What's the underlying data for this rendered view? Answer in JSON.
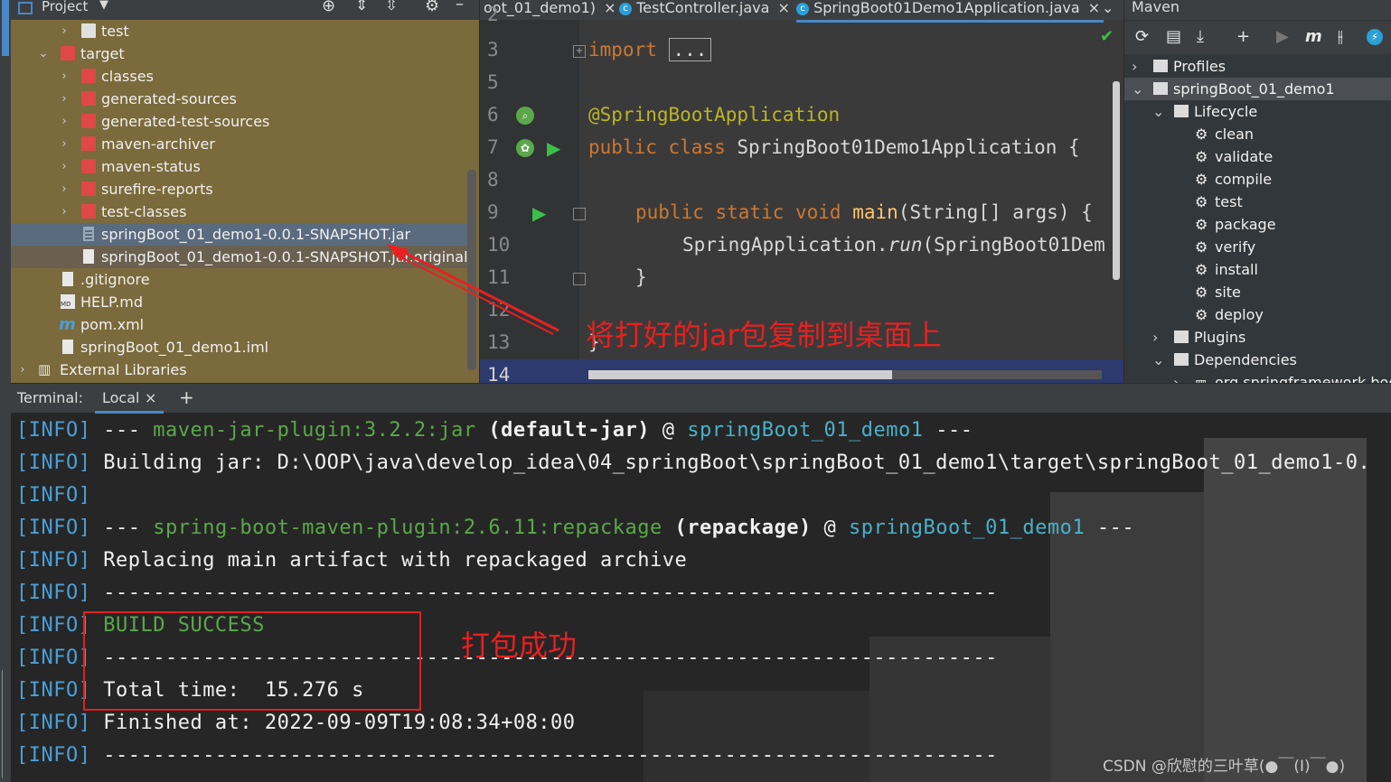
{
  "project": {
    "header_title": "Project",
    "tree": [
      {
        "label": "test",
        "kind": "folder-grey",
        "depth": 3
      },
      {
        "label": "target",
        "kind": "folder-red",
        "depth": 2
      },
      {
        "label": "classes",
        "kind": "folder-red",
        "depth": 3
      },
      {
        "label": "generated-sources",
        "kind": "folder-red",
        "depth": 3
      },
      {
        "label": "generated-test-sources",
        "kind": "folder-red",
        "depth": 3
      },
      {
        "label": "maven-archiver",
        "kind": "folder-red",
        "depth": 3
      },
      {
        "label": "maven-status",
        "kind": "folder-red",
        "depth": 3
      },
      {
        "label": "surefire-reports",
        "kind": "folder-red",
        "depth": 3
      },
      {
        "label": "test-classes",
        "kind": "folder-red",
        "depth": 3
      },
      {
        "label": "springBoot_01_demo1-0.0.1-SNAPSHOT.jar",
        "kind": "jar-file",
        "depth": 3
      },
      {
        "label": "springBoot_01_demo1-0.0.1-SNAPSHOT.jar.original",
        "kind": "file",
        "depth": 3
      },
      {
        "label": ".gitignore",
        "kind": "file",
        "depth": 2
      },
      {
        "label": "HELP.md",
        "kind": "md-file",
        "depth": 2
      },
      {
        "label": "pom.xml",
        "kind": "maven-file",
        "depth": 2
      },
      {
        "label": "springBoot_01_demo1.iml",
        "kind": "file",
        "depth": 2
      },
      {
        "label": "External Libraries",
        "kind": "libraries",
        "depth": 1
      }
    ]
  },
  "editor": {
    "tabs": [
      {
        "label": "oot_01_demo1)"
      },
      {
        "label": "TestController.java"
      },
      {
        "label": "SpringBoot01Demo1Application.java"
      }
    ],
    "line_numbers": [
      "2",
      "3",
      "5",
      "6",
      "7",
      "8",
      "9",
      "10",
      "11",
      "12",
      "13",
      "14"
    ],
    "code": {
      "import_kw": "import",
      "import_fold": "...",
      "annotation": "@SpringBootApplication",
      "class_kw": "public class",
      "class_name": " SpringBoot01Demo1Application {",
      "main_kw": "public static void",
      "main_name": "main",
      "main_args": "(String[] args) {",
      "run_prefix": "SpringApplication.",
      "run_method": "run",
      "run_suffix": "(SpringBoot01Dem",
      "close_brace_1": "}",
      "close_brace_2": "}"
    }
  },
  "maven": {
    "title": "Maven",
    "items": [
      {
        "label": "Profiles"
      },
      {
        "label": "springBoot_01_demo1"
      },
      {
        "label": "Lifecycle"
      },
      {
        "label": "clean"
      },
      {
        "label": "validate"
      },
      {
        "label": "compile"
      },
      {
        "label": "test"
      },
      {
        "label": "package"
      },
      {
        "label": "verify"
      },
      {
        "label": "install"
      },
      {
        "label": "site"
      },
      {
        "label": "deploy"
      },
      {
        "label": "Plugins"
      },
      {
        "label": "Dependencies"
      },
      {
        "label": "org.springframework.boo"
      }
    ]
  },
  "terminal": {
    "label": "Terminal:",
    "tab": "Local",
    "add": "+",
    "lines": [
      {
        "tag": "[INFO]",
        "a": " --- ",
        "b": "maven-jar-plugin:3.2.2:jar",
        "c": " (default-jar)",
        "d": " @ ",
        "e": "springBoot_01_demo1",
        "f": " ---"
      },
      {
        "tag": "[INFO]",
        "text": " Building jar: D:\\OOP\\java\\develop_idea\\04_springBoot\\springBoot_01_demo1\\target\\springBoot_01_demo1-0."
      },
      {
        "tag": "[INFO]",
        "text": ""
      },
      {
        "tag": "[INFO]",
        "a": " --- ",
        "b": "spring-boot-maven-plugin:2.6.11:repackage",
        "c": " (repackage)",
        "d": " @ ",
        "e": "springBoot_01_demo1",
        "f": " ---"
      },
      {
        "tag": "[INFO]",
        "text": " Replacing main artifact with repackaged archive"
      },
      {
        "tag": "[INFO]",
        "text": " ------------------------------------------------------------------------"
      },
      {
        "tag": "[INFO]",
        "text": " BUILD SUCCESS"
      },
      {
        "tag": "[INFO]",
        "text": " ------------------------------------------------------------------------"
      },
      {
        "tag": "[INFO]",
        "text": " Total time:  15.276 s"
      },
      {
        "tag": "[INFO]",
        "text": " Finished at: 2022-09-09T19:08:34+08:00"
      },
      {
        "tag": "[INFO]",
        "text": " ------------------------------------------------------------------------"
      }
    ]
  },
  "annotations": {
    "copy_jar_note": "将打好的jar包复制到桌面上",
    "build_success_note": "打包成功"
  },
  "watermark": "CSDN @欣慰的三叶草(●￣(I)￣●)",
  "colors": {
    "accent": "#4a88c7",
    "annotation_red": "#e82020",
    "project_bg": "#7a6a3c"
  }
}
